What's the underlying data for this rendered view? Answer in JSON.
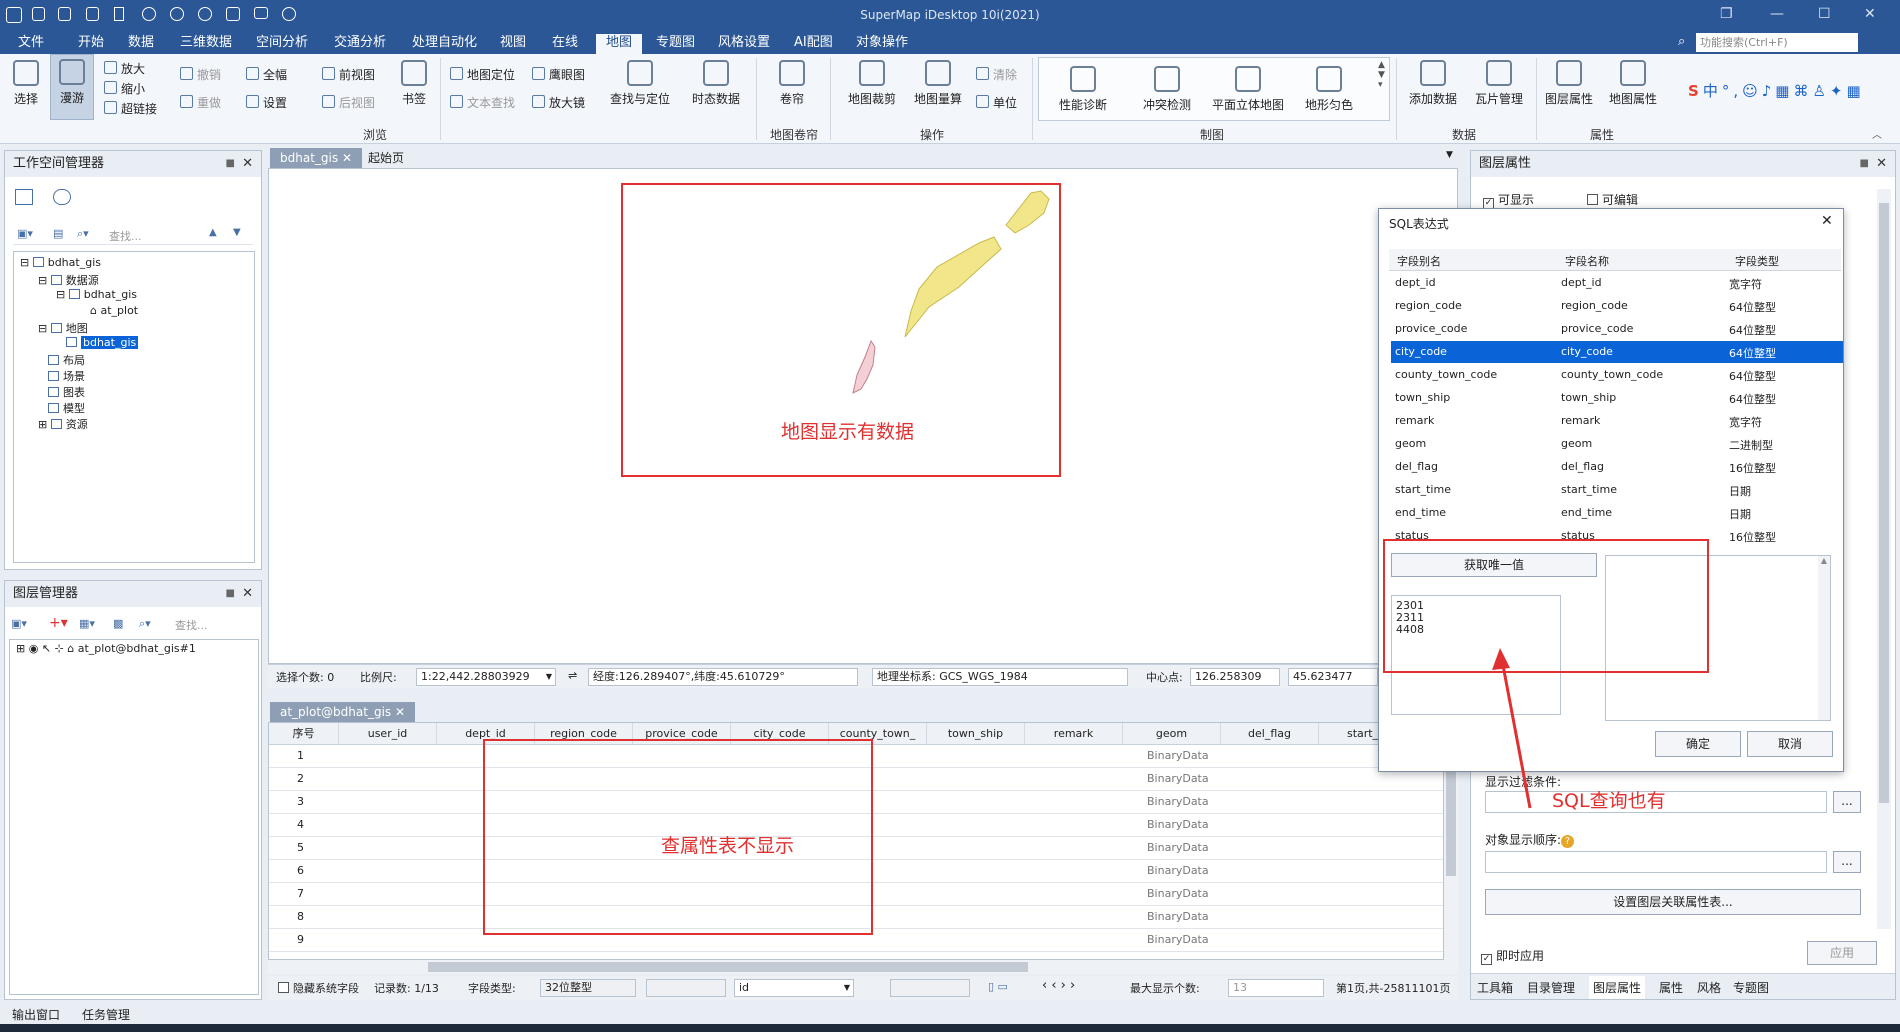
{
  "window": {
    "title": "SuperMap iDesktop 10i(2021)"
  },
  "menu": {
    "items": [
      "文件",
      "开始",
      "数据",
      "三维数据",
      "空间分析",
      "交通分析",
      "处理自动化",
      "视图",
      "在线",
      "地图",
      "专题图",
      "风格设置",
      "AI配图",
      "对象操作"
    ],
    "active": "地图",
    "search_placeholder": "功能搜索(Ctrl+F)"
  },
  "ribbon": {
    "select": "选择",
    "pan": "漫游",
    "zoom_in": "放大",
    "zoom_out": "缩小",
    "hyperlink": "超链接",
    "undo": "撤销",
    "redo": "重做",
    "full_extent": "全幅",
    "settings": "设置",
    "prev_view": "前视图",
    "next_view": "后视图",
    "bookmark": "书签",
    "map_locate": "地图定位",
    "text_find": "文本查找",
    "eagle_eye": "鹰眼图",
    "magnifier": "放大镜",
    "find_locate": "查找与定位",
    "temporal": "时态数据",
    "scroll": "卷帘",
    "map_clip": "地图裁剪",
    "map_measure": "地图量算",
    "clear": "清除",
    "unit": "单位",
    "perf": "性能诊断",
    "conflict": "冲突检测",
    "flat3d": "平面立体地图",
    "terrain": "地形匀色",
    "add_data": "添加数据",
    "tile_mgr": "瓦片管理",
    "layer_props": "图层属性",
    "map_props": "地图属性",
    "groups": {
      "browse": "浏览",
      "map_scroll": "地图卷帘",
      "ops": "操作",
      "mapping": "制图",
      "data": "数据",
      "attrs": "属性"
    }
  },
  "workspace": {
    "title": "工作空间管理器",
    "search": "查找...",
    "tree": [
      "bdhat_gis",
      "数据源",
      "bdhat_gis",
      "at_plot",
      "地图",
      "bdhat_gis",
      "布局",
      "场景",
      "图表",
      "模型",
      "资源"
    ]
  },
  "layer_manager": {
    "title": "图层管理器",
    "search": "查找...",
    "layer": "at_plot@bdhat_gis#1"
  },
  "tabs": {
    "map_tab": "bdhat_gis",
    "start_tab": "起始页",
    "attr_tab": "at_plot@bdhat_gis"
  },
  "annotations": {
    "map_has_data": "地图显示有数据",
    "attr_not_shown": "查属性表不显示",
    "sql_has": "SQL查询也有"
  },
  "statusbar": {
    "selected": "选择个数: 0",
    "scale_label": "比例尺:",
    "scale": "1:22,442.28803929",
    "coord": "经度:126.289407°,纬度:45.610729°",
    "crs": "地理坐标系: GCS_WGS_1984",
    "center_label": "中心点:",
    "center_x": "126.258309",
    "center_y": "45.623477"
  },
  "attr_table": {
    "columns": [
      "序号",
      "user_id",
      "dept_id",
      "region_code",
      "provice_code",
      "city_code",
      "county_town_",
      "town_ship",
      "remark",
      "geom",
      "del_flag",
      "start_t"
    ],
    "rows": [
      "1",
      "2",
      "3",
      "4",
      "5",
      "6",
      "7",
      "8",
      "9"
    ],
    "geom_value": "BinaryData"
  },
  "grid_status": {
    "hide_sys": "隐藏系统字段",
    "records": "记录数:  1/13",
    "field_type_label": "字段类型:",
    "field_type": "32位整型",
    "field_name": "id",
    "max_label": "最大显示个数:",
    "max": "13",
    "page": "第1页,共-25811101页"
  },
  "sql_dialog": {
    "title": "SQL表达式",
    "headers": [
      "字段别名",
      "字段名称",
      "字段类型"
    ],
    "fields": [
      [
        "dept_id",
        "dept_id",
        "宽字符"
      ],
      [
        "region_code",
        "region_code",
        "64位整型"
      ],
      [
        "provice_code",
        "provice_code",
        "64位整型"
      ],
      [
        "city_code",
        "city_code",
        "64位整型"
      ],
      [
        "county_town_code",
        "county_town_code",
        "64位整型"
      ],
      [
        "town_ship",
        "town_ship",
        "64位整型"
      ],
      [
        "remark",
        "remark",
        "宽字符"
      ],
      [
        "geom",
        "geom",
        "二进制型"
      ],
      [
        "del_flag",
        "del_flag",
        "16位整型"
      ],
      [
        "start_time",
        "start_time",
        "日期"
      ],
      [
        "end_time",
        "end_time",
        "日期"
      ],
      [
        "status",
        "status",
        "16位整型"
      ]
    ],
    "unique_btn": "获取唯一值",
    "unique_values": [
      "2301",
      "2311",
      "4408"
    ],
    "ok": "确定",
    "cancel": "取消"
  },
  "layer_props": {
    "title": "图层属性",
    "visible": "可显示",
    "editable": "可编辑",
    "filter_label": "显示过滤条件:",
    "order_label": "对象显示顺序:",
    "assoc_btn": "设置图层关联属性表...",
    "instant": "即时应用",
    "apply": "应用"
  },
  "right_tabs": [
    "工具箱",
    "目录管理",
    "图层属性",
    "属性",
    "风格",
    "专题图"
  ],
  "bottom_tabs": [
    "输出窗口",
    "任务管理"
  ],
  "colors": {
    "brand": "#2b5797",
    "selection": "#0a64d8",
    "annotation": "#e03030",
    "feature_fill": "#f2e68a"
  }
}
